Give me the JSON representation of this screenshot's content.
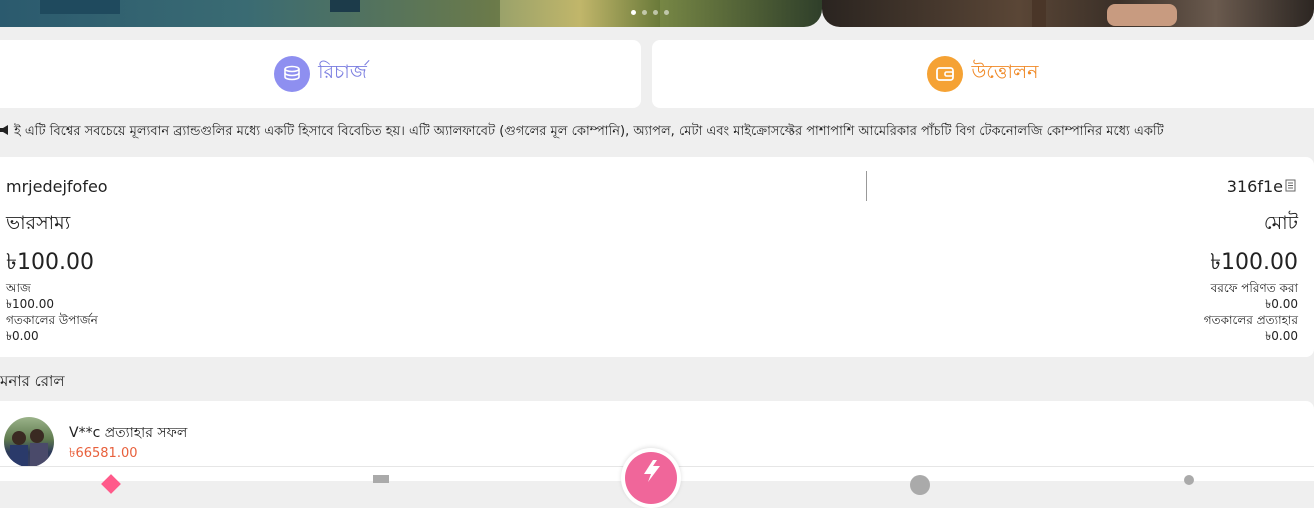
{
  "banner": {
    "slides_total": 4,
    "active_slide": 1
  },
  "actions": {
    "recharge_label": "রিচার্জ",
    "withdraw_label": "উত্তোলন",
    "recharge_icon": "coins-stack-icon",
    "withdraw_icon": "wallet-icon",
    "recharge_color": "#8e8ff0",
    "withdraw_color": "#f5a234"
  },
  "marquee": {
    "text": "ই এটি বিশ্বের সবচেয়ে মূল্যবান ব্র্যান্ডগুলির মধ্যে একটি হিসাবে বিবেচিত হয়। এটি অ্যালফাবেট (গুগলের মূল কোম্পানি), অ্যাপল, মেটা এবং মাইক্রোসফ্টের পাশাপাশি আমেরিকার পাঁচটি বিগ টেকনোলজি কোম্পানির মধ্যে একটি"
  },
  "account": {
    "username": "mrjedejfofeo",
    "code": "316f1e",
    "balance_label": "ভারসাম্য",
    "total_label": "মোট",
    "balance_value": "৳100.00",
    "total_value": "৳100.00",
    "today_label": "আজ",
    "today_value": "৳100.00",
    "yesterday_earning_label": "গতকালের উপার্জন",
    "yesterday_earning_value": "৳0.00",
    "frozen_label": "বরফে পরিণত করা",
    "frozen_value": "৳0.00",
    "yesterday_withdraw_label": "গতকালের প্রত্যাহার",
    "yesterday_withdraw_value": "৳0.00"
  },
  "section": {
    "title": "মনার রোল"
  },
  "notices": [
    {
      "text": "V**c প্রত্যাহার সফল",
      "amount": "৳66581.00"
    }
  ],
  "colors": {
    "accent_pink": "#f0669a",
    "amount_red": "#e8603c"
  }
}
